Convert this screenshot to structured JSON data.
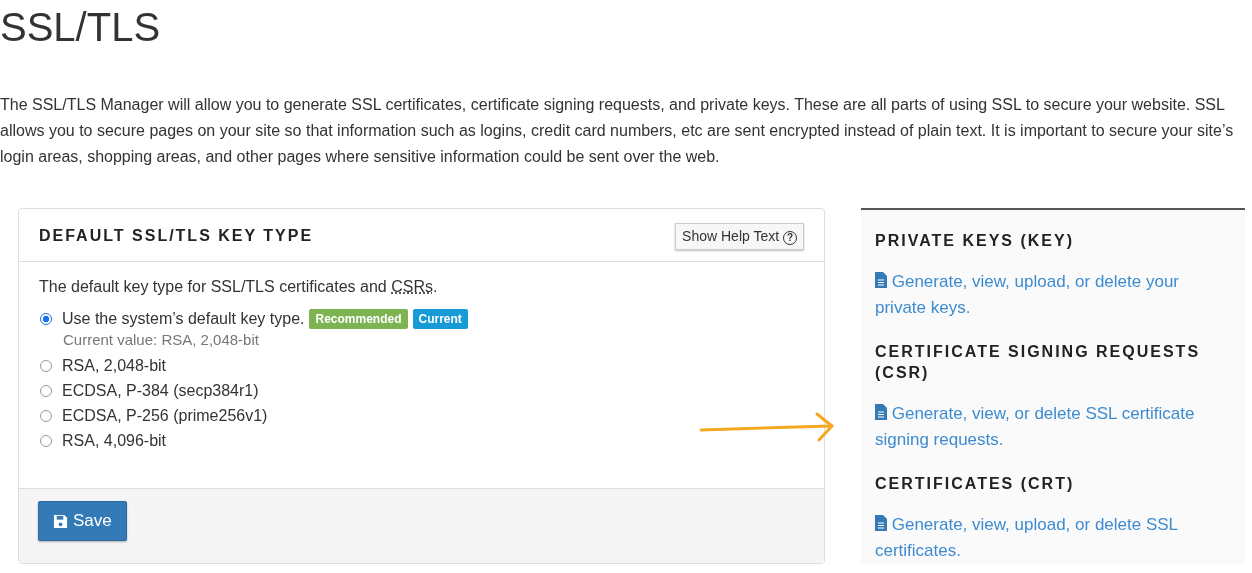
{
  "page_title": "SSL/TLS",
  "intro": "The SSL/TLS Manager will allow you to generate SSL certificates, certificate signing requests, and private keys. These are all parts of using SSL to secure your website. SSL allows you to secure pages on your site so that information such as logins, credit card numbers, etc are sent encrypted instead of plain text. It is important to secure your site’s login areas, shopping areas, and other pages where sensitive information could be sent over the web.",
  "panel": {
    "title": "DEFAULT SSL/TLS KEY TYPE",
    "help_button": "Show Help Text",
    "help_icon": "?",
    "description_start": "The default key type for SSL/TLS certificates and ",
    "description_abbr": "CSRs",
    "description_end": ".",
    "options": [
      {
        "label": "Use the system’s default key type.",
        "selected": true,
        "badges": [
          {
            "label": "Recommended",
            "color": "#7db351"
          },
          {
            "label": "Current",
            "color": "#179bd7"
          }
        ],
        "note": "Current value: RSA, 2,048-bit"
      },
      {
        "label": "RSA, 2,048-bit",
        "selected": false
      },
      {
        "label": "ECDSA, P-384 (secp384r1)",
        "selected": false
      },
      {
        "label": "ECDSA, P-256 (prime256v1)",
        "selected": false
      },
      {
        "label": "RSA, 4,096-bit",
        "selected": false
      }
    ],
    "save_button": "Save"
  },
  "sections": [
    {
      "heading": "PRIVATE KEYS (KEY)",
      "link": "Generate, view, upload, or delete your private keys."
    },
    {
      "heading": "CERTIFICATE SIGNING REQUESTS (CSR)",
      "link": "Generate, view, or delete SSL certificate signing requests."
    },
    {
      "heading": "CERTIFICATES (CRT)",
      "link": "Generate, view, upload, or delete SSL certificates."
    }
  ],
  "annotation": {
    "kind": "arrow"
  }
}
